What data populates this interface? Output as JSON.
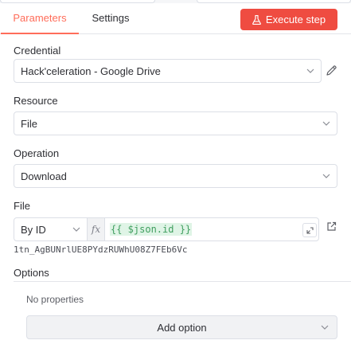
{
  "tabs": [
    {
      "label": "Parameters",
      "active": true
    },
    {
      "label": "Settings",
      "active": false
    }
  ],
  "execute_button": {
    "label": "Execute step",
    "color": "#ef4c41",
    "icon": "flask-icon"
  },
  "credential": {
    "label": "Credential",
    "value": "Hack'celeration - Google Drive"
  },
  "resource": {
    "label": "Resource",
    "value": "File"
  },
  "operation": {
    "label": "Operation",
    "value": "Download"
  },
  "file": {
    "label": "File",
    "mode": "By ID",
    "fx": "fx",
    "expression": "{{ $json.id }}",
    "resolved": "1tn_AgBUNrlUE8PYdzRUWhU08Z7FEb6Vc"
  },
  "options": {
    "label": "Options",
    "empty_text": "No properties",
    "add_label": "Add option"
  },
  "accent": "#ff6d5a"
}
